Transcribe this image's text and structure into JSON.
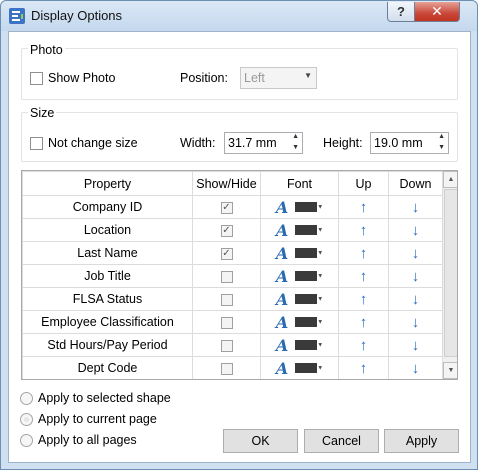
{
  "window": {
    "title": "Display Options",
    "help_label": "?",
    "close_label": "✕"
  },
  "photo": {
    "group_label": "Photo",
    "show_photo_label": "Show Photo",
    "show_photo_checked": false,
    "position_label": "Position:",
    "position_value": "Left"
  },
  "size": {
    "group_label": "Size",
    "not_change_label": "Not change size",
    "not_change_checked": false,
    "width_label": "Width:",
    "width_value": "31.7 mm",
    "height_label": "Height:",
    "height_value": "19.0 mm"
  },
  "grid": {
    "headers": {
      "property": "Property",
      "show_hide": "Show/Hide",
      "font": "Font",
      "up": "Up",
      "down": "Down"
    },
    "rows": [
      {
        "property": "Company ID",
        "checked": true
      },
      {
        "property": "Location",
        "checked": true
      },
      {
        "property": "Last Name",
        "checked": true
      },
      {
        "property": "Job Title",
        "checked": false
      },
      {
        "property": "FLSA Status",
        "checked": false
      },
      {
        "property": "Employee Classification",
        "checked": false
      },
      {
        "property": "Std Hours/Pay Period",
        "checked": false
      },
      {
        "property": "Dept Code",
        "checked": false
      }
    ],
    "font_glyph": "A",
    "font_color": "#3a3a3a",
    "up_glyph": "🡑",
    "down_glyph": "🡓"
  },
  "apply_scope": {
    "options": [
      {
        "label": "Apply to selected shape",
        "selected": false
      },
      {
        "label": "Apply to current page",
        "selected": true
      },
      {
        "label": "Apply to all pages",
        "selected": false
      }
    ]
  },
  "buttons": {
    "ok": "OK",
    "cancel": "Cancel",
    "apply": "Apply"
  },
  "colors": {
    "accent": "#2c6fc0",
    "title_bar": "#c4d8ee",
    "close_red": "#c9483a"
  }
}
